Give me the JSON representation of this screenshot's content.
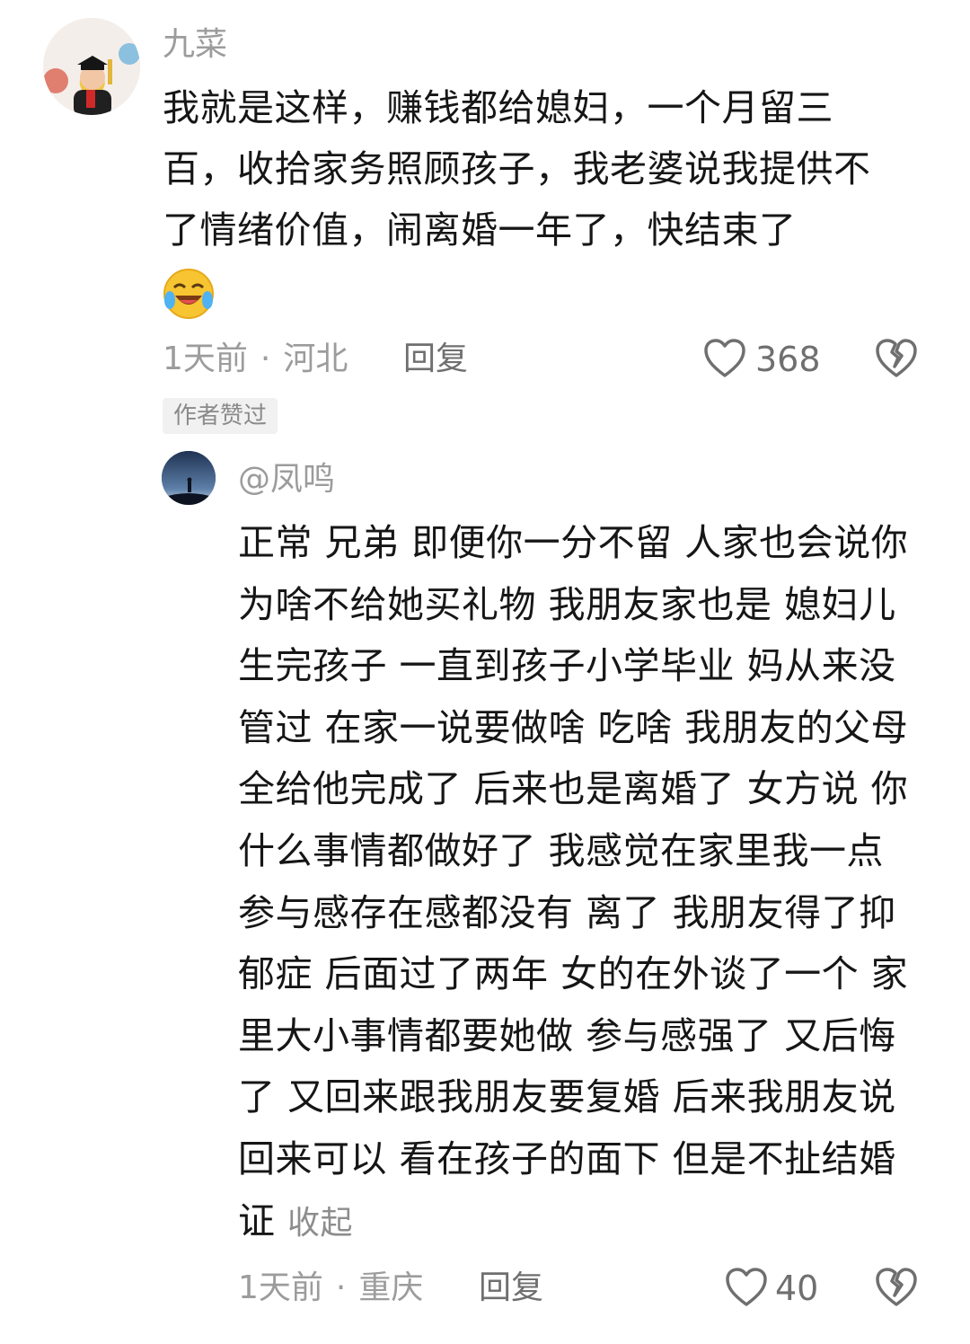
{
  "comment": {
    "username": "九菜",
    "text": "我就是这样，赚钱都给媳妇，一个月留三百，收拾家务照顾孩子，我老婆说我提供不了情绪价值，闹离婚一年了，快结束了",
    "emoji": "laughing-crying-emoji",
    "time": "1天前",
    "location": "河北",
    "reply_label": "回复",
    "like_count": "368",
    "badge": "作者赞过"
  },
  "reply": {
    "username": "@凤鸣",
    "text": "正常 兄弟 即便你一分不留 人家也会说你 为啥不给她买礼物 我朋友家也是 媳妇儿生完孩子 一直到孩子小学毕业 妈从来没管过 在家一说要做啥 吃啥 我朋友的父母全给他完成了 后来也是离婚了 女方说 你什么事情都做好了 我感觉在家里我一点参与感存在感都没有 离了 我朋友得了抑郁症 后面过了两年 女的在外谈了一个 家里大小事情都要她做 参与感强了 又后悔了 又回来跟我朋友要复婚 后来我朋友说回来可以 看在孩子的面下 但是不扯结婚证",
    "collapse_label": "收起",
    "time": "1天前",
    "location": "重庆",
    "reply_label": "回复",
    "like_count": "40"
  },
  "icons": {
    "like": "heart-outline-icon",
    "dislike": "broken-heart-icon"
  }
}
